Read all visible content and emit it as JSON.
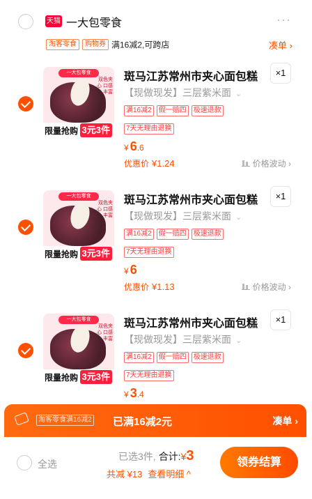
{
  "shop": {
    "badge": "天猫",
    "name": "一大包零食",
    "arrow": "›",
    "more": "···",
    "promo_tags": [
      "淘客零食",
      "购物券"
    ],
    "promo_text": "满16减2,可跨店",
    "promo_link": "凑单 ›"
  },
  "items": [
    {
      "checked": true,
      "thumb": {
        "top": "一大包零食",
        "side": "双色夹心 口感丰富",
        "banner": "限量抢购",
        "price": "3元3件"
      },
      "title": "斑马江苏常州市夹心面包糕",
      "qty": "×1",
      "sku": "【现做现发】三层紫米面",
      "tags": [
        "满16减2",
        "假一赔四",
        "极速退款"
      ],
      "service": "7天无理由退换",
      "price_cur": "¥",
      "price_int": "6",
      "price_dec": ".6",
      "deal_label": "优惠价",
      "deal_price": "¥1.24",
      "fluct": "价格波动 ›"
    },
    {
      "checked": true,
      "thumb": {
        "top": "一大包零食",
        "side": "双色夹心 口感丰富",
        "banner": "限量抢购",
        "price": "3元3件"
      },
      "title": "斑马江苏常州市夹心面包糕",
      "qty": "×1",
      "sku": "【现做现发】三层紫米面",
      "tags": [
        "满16减2",
        "假一赔四",
        "极速退款"
      ],
      "service": "7天无理由退换",
      "price_cur": "¥",
      "price_int": "6",
      "price_dec": "",
      "deal_label": "优惠价",
      "deal_price": "¥1.13",
      "fluct": "价格波动 ›"
    },
    {
      "checked": true,
      "thumb": {
        "top": "一大包零食",
        "side": "双色夹心 口感丰富",
        "banner": "限量抢购",
        "price": "3元3件"
      },
      "title": "斑马江苏常州市夹心面包糕",
      "qty": "×1",
      "sku": "【现做现发】三层紫米面",
      "tags": [
        "满16减2",
        "假一赔四",
        "极速退款"
      ],
      "service": "7天无理由退换",
      "price_cur": "¥",
      "price_int": "3",
      "price_dec": ".4",
      "deal_label": "",
      "deal_price": "",
      "fluct": ""
    }
  ],
  "discount_bar": {
    "tag": "淘客零食满16减2",
    "text": "已满16减2元",
    "link": "凑单 ›"
  },
  "footer": {
    "select_all": "全选",
    "selected": "已选3件,",
    "total_label": "合计:",
    "total_cur": "¥",
    "total": "3",
    "saved": "共减 ¥13",
    "detail": "查看明细 ^",
    "checkout": "领券结算"
  },
  "colors": {
    "accent": "#ff5000",
    "tmall": "#ff0036"
  }
}
